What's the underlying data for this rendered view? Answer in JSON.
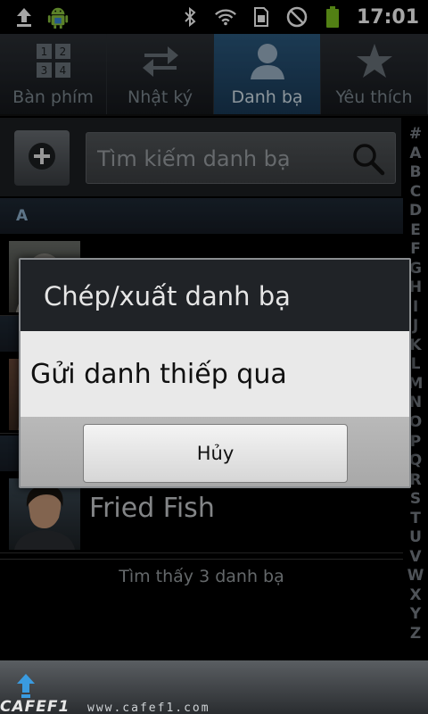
{
  "status_bar": {
    "time": "17:01",
    "icons": [
      "upload-icon",
      "android-icon",
      "bluetooth-icon",
      "wifi-icon",
      "sim-icon",
      "no-signal-icon",
      "battery-icon"
    ]
  },
  "tabs": [
    {
      "label": "Bàn phím",
      "icon": "keypad-icon"
    },
    {
      "label": "Nhật ký",
      "icon": "swap-arrows-icon"
    },
    {
      "label": "Danh bạ",
      "icon": "person-icon",
      "active": true
    },
    {
      "label": "Yêu thích",
      "icon": "star-icon"
    }
  ],
  "search": {
    "placeholder": "Tìm kiếm danh bạ"
  },
  "index_letters": [
    "#",
    "A",
    "B",
    "C",
    "D",
    "E",
    "F",
    "G",
    "H",
    "I",
    "J",
    "K",
    "L",
    "M",
    "N",
    "O",
    "P",
    "Q",
    "R",
    "S",
    "T",
    "U",
    "V",
    "W",
    "X",
    "Y",
    "Z"
  ],
  "list": {
    "sections": [
      {
        "header": "A"
      }
    ],
    "contacts": [
      {
        "name": "Fried Fish"
      }
    ],
    "footer": "Tìm thấy 3 danh bạ"
  },
  "dialog": {
    "title": "Chép/xuất danh bạ",
    "option": "Gửi danh thiếp qua",
    "cancel_label": "Hủy"
  },
  "watermark": {
    "brand": "CAFEF1",
    "url": "www.cafef1.com"
  },
  "colors": {
    "active_tab": "#2b5a80",
    "section_text": "#8fb3cf",
    "battery": "#7ec520"
  }
}
